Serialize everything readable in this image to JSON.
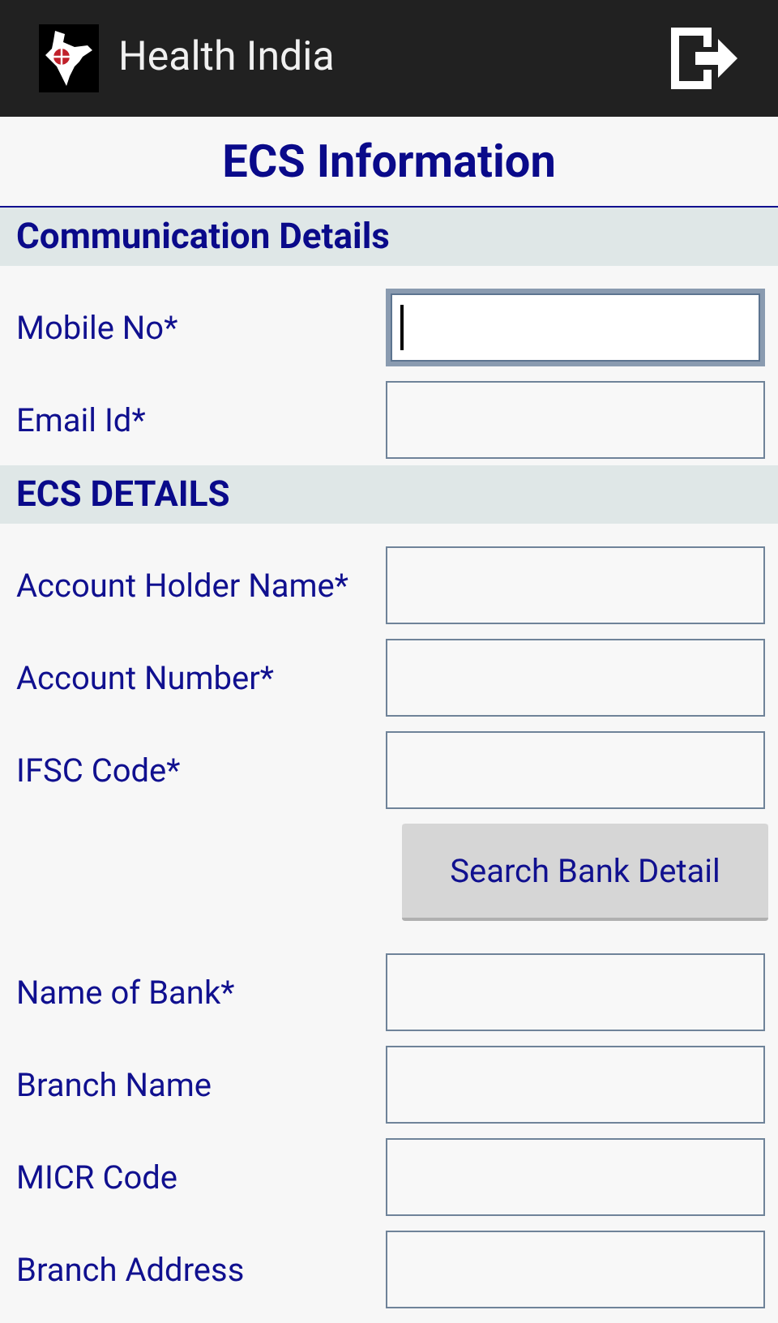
{
  "app_bar": {
    "title": "Health India"
  },
  "page_title": "ECS Information",
  "sections": [
    {
      "title": "Communication Details",
      "items": [
        {
          "kind": "field",
          "label": "Mobile No*",
          "focused": true
        },
        {
          "kind": "field",
          "label": "Email Id*",
          "focused": false
        }
      ]
    },
    {
      "title": "ECS DETAILS",
      "items": [
        {
          "kind": "field",
          "label": "Account Holder Name*",
          "focused": false
        },
        {
          "kind": "field",
          "label": "Account Number*",
          "focused": false
        },
        {
          "kind": "field",
          "label": "IFSC Code*",
          "focused": false
        },
        {
          "kind": "button",
          "label": "Search Bank Detail"
        },
        {
          "kind": "field",
          "label": "Name of Bank*",
          "focused": false
        },
        {
          "kind": "field",
          "label": "Branch Name",
          "focused": false
        },
        {
          "kind": "field",
          "label": "MICR Code",
          "focused": false
        },
        {
          "kind": "field",
          "label": "Branch Address",
          "focused": false
        }
      ]
    }
  ]
}
